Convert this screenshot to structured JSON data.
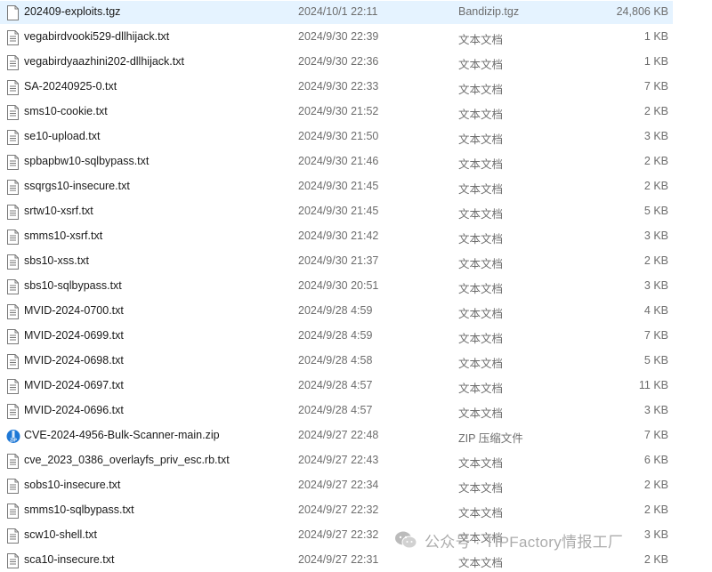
{
  "files": [
    {
      "name": "202409-exploits.tgz",
      "date": "2024/10/1 22:11",
      "type": "Bandizip.tgz",
      "size": "24,806 KB",
      "icon": "blank-file-icon",
      "selected": true
    },
    {
      "name": "vegabirdvooki529-dllhijack.txt",
      "date": "2024/9/30 22:39",
      "type": "文本文档",
      "size": "1 KB",
      "icon": "text-file-icon"
    },
    {
      "name": "vegabirdyaazhini202-dllhijack.txt",
      "date": "2024/9/30 22:36",
      "type": "文本文档",
      "size": "1 KB",
      "icon": "text-file-icon"
    },
    {
      "name": "SA-20240925-0.txt",
      "date": "2024/9/30 22:33",
      "type": "文本文档",
      "size": "7 KB",
      "icon": "text-file-icon"
    },
    {
      "name": "sms10-cookie.txt",
      "date": "2024/9/30 21:52",
      "type": "文本文档",
      "size": "2 KB",
      "icon": "text-file-icon"
    },
    {
      "name": "se10-upload.txt",
      "date": "2024/9/30 21:50",
      "type": "文本文档",
      "size": "3 KB",
      "icon": "text-file-icon"
    },
    {
      "name": "spbapbw10-sqlbypass.txt",
      "date": "2024/9/30 21:46",
      "type": "文本文档",
      "size": "2 KB",
      "icon": "text-file-icon"
    },
    {
      "name": "ssqrgs10-insecure.txt",
      "date": "2024/9/30 21:45",
      "type": "文本文档",
      "size": "2 KB",
      "icon": "text-file-icon"
    },
    {
      "name": "srtw10-xsrf.txt",
      "date": "2024/9/30 21:45",
      "type": "文本文档",
      "size": "5 KB",
      "icon": "text-file-icon"
    },
    {
      "name": "smms10-xsrf.txt",
      "date": "2024/9/30 21:42",
      "type": "文本文档",
      "size": "3 KB",
      "icon": "text-file-icon"
    },
    {
      "name": "sbs10-xss.txt",
      "date": "2024/9/30 21:37",
      "type": "文本文档",
      "size": "2 KB",
      "icon": "text-file-icon"
    },
    {
      "name": "sbs10-sqlbypass.txt",
      "date": "2024/9/30 20:51",
      "type": "文本文档",
      "size": "3 KB",
      "icon": "text-file-icon"
    },
    {
      "name": "MVID-2024-0700.txt",
      "date": "2024/9/28 4:59",
      "type": "文本文档",
      "size": "4 KB",
      "icon": "text-file-icon"
    },
    {
      "name": "MVID-2024-0699.txt",
      "date": "2024/9/28 4:59",
      "type": "文本文档",
      "size": "7 KB",
      "icon": "text-file-icon"
    },
    {
      "name": "MVID-2024-0698.txt",
      "date": "2024/9/28 4:58",
      "type": "文本文档",
      "size": "5 KB",
      "icon": "text-file-icon"
    },
    {
      "name": "MVID-2024-0697.txt",
      "date": "2024/9/28 4:57",
      "type": "文本文档",
      "size": "11 KB",
      "icon": "text-file-icon"
    },
    {
      "name": "MVID-2024-0696.txt",
      "date": "2024/9/28 4:57",
      "type": "文本文档",
      "size": "3 KB",
      "icon": "text-file-icon"
    },
    {
      "name": "CVE-2024-4956-Bulk-Scanner-main.zip",
      "date": "2024/9/27 22:48",
      "type": "ZIP 压缩文件",
      "size": "7 KB",
      "icon": "zip-archive-icon"
    },
    {
      "name": "cve_2023_0386_overlayfs_priv_esc.rb.txt",
      "date": "2024/9/27 22:43",
      "type": "文本文档",
      "size": "6 KB",
      "icon": "text-file-icon"
    },
    {
      "name": "sobs10-insecure.txt",
      "date": "2024/9/27 22:34",
      "type": "文本文档",
      "size": "2 KB",
      "icon": "text-file-icon"
    },
    {
      "name": "smms10-sqlbypass.txt",
      "date": "2024/9/27 22:32",
      "type": "文本文档",
      "size": "2 KB",
      "icon": "text-file-icon"
    },
    {
      "name": "scw10-shell.txt",
      "date": "2024/9/27 22:32",
      "type": "文本文档",
      "size": "3 KB",
      "icon": "text-file-icon"
    },
    {
      "name": "sca10-insecure.txt",
      "date": "2024/9/27 22:31",
      "type": "文本文档",
      "size": "2 KB",
      "icon": "text-file-icon"
    }
  ],
  "watermark": {
    "text": "公众号 · TIPFactory情报工厂",
    "icon": "wechat-logo-icon"
  },
  "colors": {
    "selected_row": "#e5f3ff",
    "zip_icon": "#1e78d6",
    "secondary_text": "#6d6d6d"
  }
}
